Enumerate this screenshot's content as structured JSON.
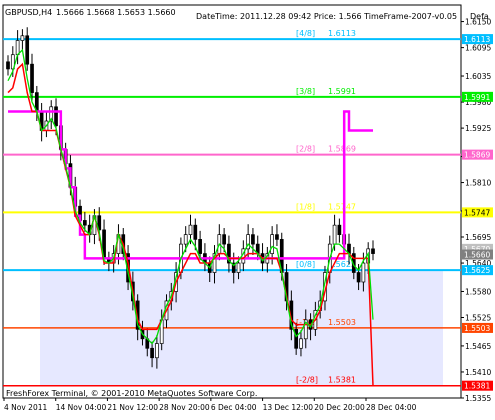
{
  "header": {
    "symbol": "GBPUSD,H4",
    "ohlc": "1.5666 1.5668 1.5653 1.5660",
    "indicator_info": "DateTime: 2011.12.28 09:42   Price: 1.566   TimeFrame-2007-v0.05",
    "cut_label": "Defa"
  },
  "footer": {
    "copyright": "FreshForex Terminal, © 2001-2010 MetaQuotes Software Corp."
  },
  "colors": {
    "background": "#ffffff",
    "candles": "#000000",
    "level_4_8": "#00bfff",
    "level_3_8": "#00ee00",
    "level_2_8": "#ff66cc",
    "level_1_8": "#ffff00",
    "level_0_8": "#00bfff",
    "level_minus1_8": "#ff4500",
    "level_minus2_8": "#ff0000",
    "magenta_line": "#ff00ff",
    "red_line": "#ff0000",
    "green_line": "#00dd00",
    "range_fill": "#e6e8ff"
  },
  "chart_data": {
    "type": "candlestick",
    "title": "GBPUSD,H4",
    "ylim": [
      1.5355,
      1.6185
    ],
    "yticks": [
      "1.6150",
      "1.6095",
      "1.6035",
      "1.5980",
      "1.5925",
      "1.5865",
      "1.5810",
      "1.5750",
      "1.5695",
      "1.5640",
      "1.5580",
      "1.5525",
      "1.5465",
      "1.5410",
      "1.5355"
    ],
    "xticks": [
      "4 Nov 2011",
      "14 Nov 04:00",
      "21 Nov 12:00",
      "28 Nov 20:00",
      "6 Dec 04:00",
      "13 Dec 12:00",
      "20 Dec 20:00",
      "28 Dec 04:00"
    ],
    "murrey_levels": [
      {
        "label": "[4/8]",
        "value": 1.6113,
        "value_text": "1.6113",
        "axis_tag": "1.6113",
        "color": "#00bfff"
      },
      {
        "label": "[3/8]",
        "value": 1.5991,
        "value_text": "1.5991",
        "axis_tag": "1.5991",
        "color": "#00ee00"
      },
      {
        "label": "[2/8]",
        "value": 1.5869,
        "value_text": "1.5869",
        "axis_tag": "1.5869",
        "color": "#ff66cc"
      },
      {
        "label": "[1/8]",
        "value": 1.5747,
        "value_text": "1.5747",
        "axis_tag": "1.5747",
        "color": "#ffff00"
      },
      {
        "label": "[0/8]",
        "value": 1.5625,
        "value_text": "1.5625",
        "axis_tag": "1.5625",
        "color": "#00bfff"
      },
      {
        "label": "[-1/8]",
        "value": 1.5503,
        "value_text": "1.5503",
        "axis_tag": "1.5503",
        "color": "#ff4500"
      },
      {
        "label": "[-2/8]",
        "value": 1.5381,
        "value_text": "1.5381",
        "axis_tag": "1.5381",
        "color": "#ff0000"
      }
    ],
    "price_tags": [
      {
        "text": "1.5670",
        "value": 1.567,
        "color": "#c0c0c0"
      },
      {
        "text": "1.5660",
        "value": 1.5658,
        "color": "#808080"
      }
    ],
    "series": [
      {
        "kind": "close",
        "values": [
          1.605,
          1.608,
          1.611,
          1.612,
          1.606,
          1.6,
          1.596,
          1.592,
          1.594,
          1.597,
          1.593,
          1.588,
          1.585,
          1.58,
          1.576,
          1.573,
          1.572,
          1.57,
          1.574,
          1.571,
          1.565,
          1.564,
          1.566,
          1.57,
          1.566,
          1.56,
          1.556,
          1.55,
          1.548,
          1.546,
          1.544,
          1.547,
          1.552,
          1.556,
          1.558,
          1.562,
          1.568,
          1.57,
          1.572,
          1.569,
          1.566,
          1.564,
          1.562,
          1.566,
          1.57,
          1.568,
          1.564,
          1.562,
          1.564,
          1.567,
          1.57,
          1.568,
          1.566,
          1.564,
          1.566,
          1.57,
          1.569,
          1.562,
          1.556,
          1.55,
          1.546,
          1.548,
          1.552,
          1.55,
          1.554,
          1.556,
          1.562,
          1.568,
          1.572,
          1.57,
          1.568,
          1.566,
          1.562,
          1.56,
          1.564,
          1.567,
          1.566
        ]
      },
      {
        "kind": "red_line",
        "values": [
          1.6,
          1.601,
          1.605,
          1.606,
          1.6,
          1.596,
          1.596,
          1.592,
          1.592,
          1.592,
          1.592,
          1.588,
          1.584,
          1.58,
          1.574,
          1.572,
          1.57,
          1.57,
          1.574,
          1.57,
          1.564,
          1.564,
          1.564,
          1.57,
          1.568,
          1.564,
          1.558,
          1.552,
          1.55,
          1.55,
          1.55,
          1.55,
          1.552,
          1.554,
          1.556,
          1.56,
          1.562,
          1.564,
          1.566,
          1.566,
          1.564,
          1.564,
          1.564,
          1.565,
          1.566,
          1.566,
          1.565,
          1.565,
          1.565,
          1.565,
          1.566,
          1.566,
          1.566,
          1.565,
          1.565,
          1.565,
          1.565,
          1.562,
          1.557,
          1.552,
          1.551,
          1.551,
          1.551,
          1.551,
          1.552,
          1.554,
          1.558,
          1.562,
          1.564,
          1.566,
          1.566,
          1.566,
          1.565,
          1.565,
          1.565,
          1.565,
          1.5381
        ]
      },
      {
        "kind": "magenta_line",
        "values": [
          1.596,
          1.596,
          1.596,
          1.596,
          1.596,
          1.596,
          1.596,
          1.596,
          1.596,
          1.596,
          1.596,
          1.588,
          1.584,
          1.58,
          1.574,
          1.57,
          1.565,
          1.565,
          1.565,
          1.565,
          1.565,
          1.565,
          1.565,
          1.565,
          1.565,
          1.565,
          1.565,
          1.565,
          1.565,
          1.565,
          1.565,
          1.565,
          1.565,
          1.565,
          1.565,
          1.565,
          1.565,
          1.565,
          1.565,
          1.565,
          1.565,
          1.565,
          1.565,
          1.565,
          1.565,
          1.565,
          1.565,
          1.565,
          1.565,
          1.565,
          1.565,
          1.565,
          1.565,
          1.565,
          1.565,
          1.565,
          1.565,
          1.565,
          1.565,
          1.565,
          1.565,
          1.565,
          1.565,
          1.565,
          1.565,
          1.565,
          1.565,
          1.565,
          1.565,
          1.565,
          1.596,
          1.592,
          1.592,
          1.592,
          1.592,
          1.592,
          1.592
        ]
      }
    ]
  }
}
